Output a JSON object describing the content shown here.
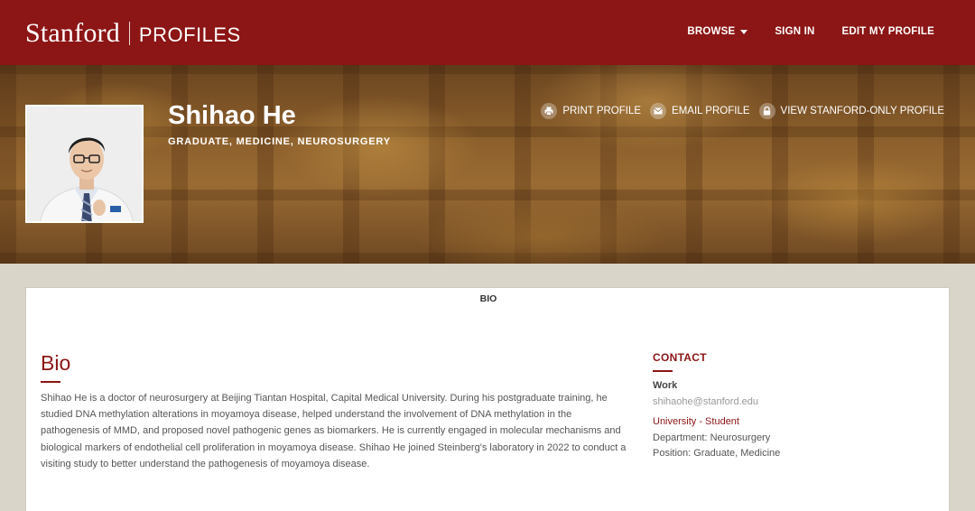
{
  "header": {
    "brand": "Stanford",
    "product": "PROFILES",
    "nav": [
      {
        "label": "BROWSE",
        "has_dropdown": true
      },
      {
        "label": "SIGN IN"
      },
      {
        "label": "EDIT MY PROFILE"
      }
    ]
  },
  "profile": {
    "name": "Shihao He",
    "subtitle": "GRADUATE, MEDICINE, NEUROSURGERY",
    "actions": [
      {
        "label": "PRINT PROFILE",
        "icon": "print-icon"
      },
      {
        "label": "EMAIL PROFILE",
        "icon": "envelope-icon"
      },
      {
        "label": "VIEW STANFORD-ONLY PROFILE",
        "icon": "lock-icon"
      }
    ]
  },
  "tabs": {
    "active": "BIO"
  },
  "bio": {
    "heading": "Bio",
    "text": "Shihao He is a doctor of neurosurgery at Beijing Tiantan Hospital, Capital Medical University. During his postgraduate training, he studied DNA methylation alterations in moyamoya disease, helped understand the involvement of DNA methylation in the pathogenesis of MMD, and proposed novel pathogenic genes as biomarkers. He is currently engaged in molecular mechanisms and biological markers of endothelial cell proliferation in moyamoya disease. Shihao He joined Steinberg's laboratory in 2022 to conduct a visiting study to better understand the pathogenesis of moyamoya disease."
  },
  "contact": {
    "heading": "CONTACT",
    "work_label": "Work",
    "email": "shihaohe@stanford.edu",
    "role": "University - Student",
    "department": "Department: Neurosurgery",
    "position": "Position: Graduate, Medicine"
  },
  "colors": {
    "cardinal": "#8c1515",
    "page_bg": "#d9d5c9"
  }
}
